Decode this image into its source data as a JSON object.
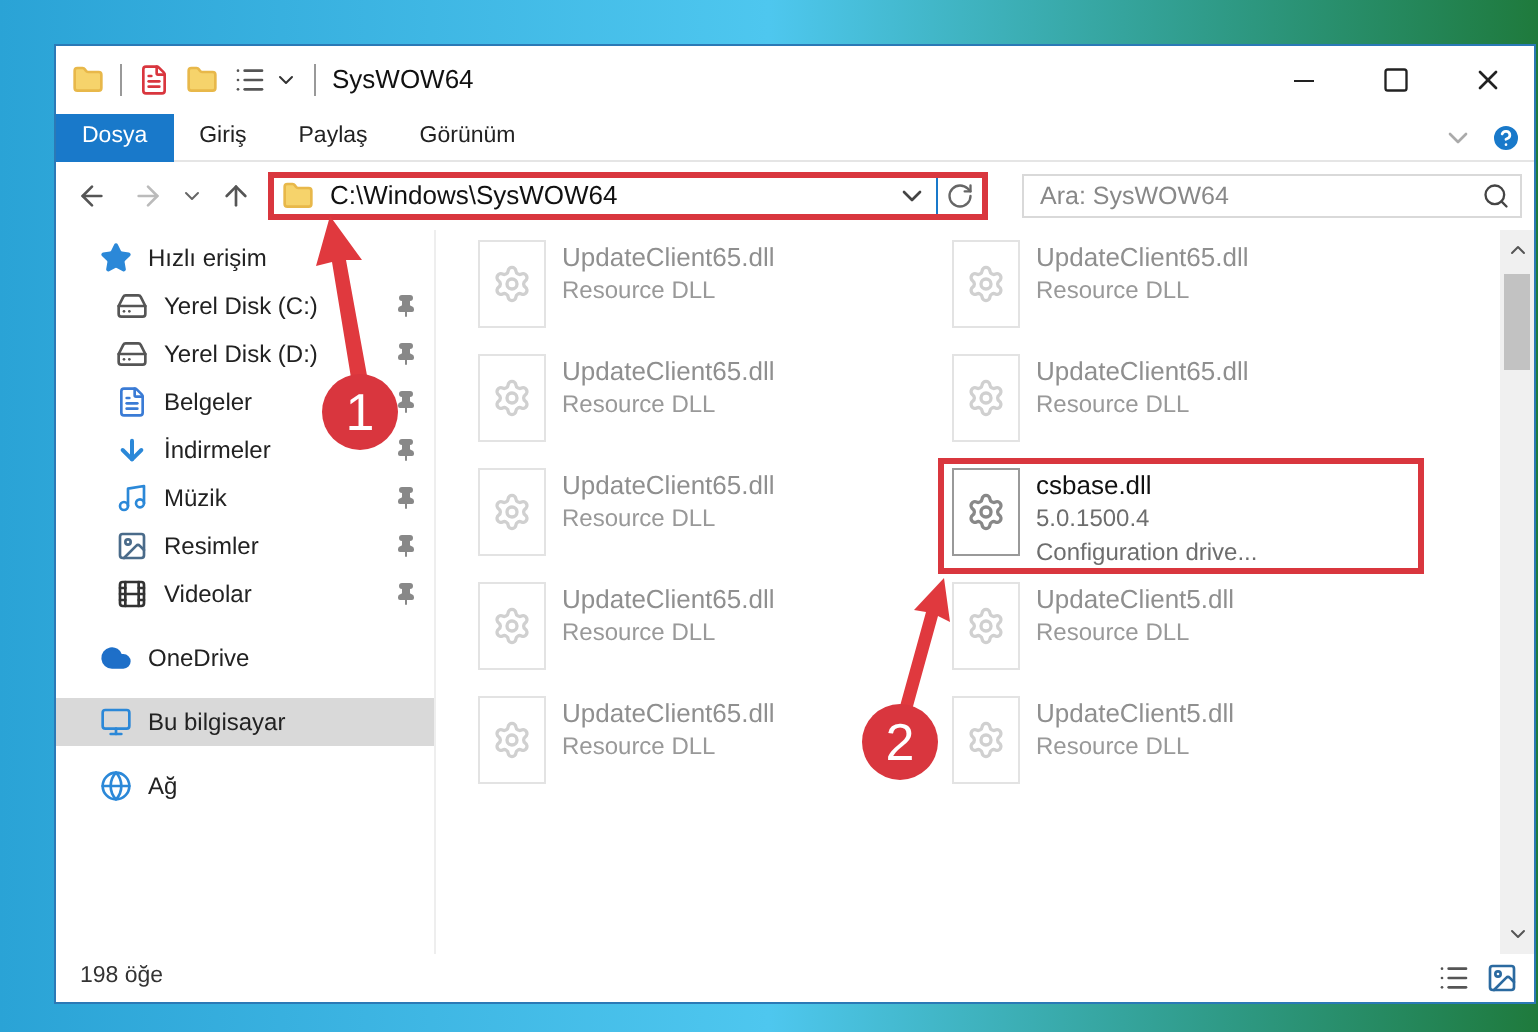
{
  "window": {
    "title": "SysWOW64"
  },
  "ribbon_tabs": [
    {
      "label": "Dosya",
      "selected": true
    },
    {
      "label": "Giriş",
      "selected": false
    },
    {
      "label": "Paylaş",
      "selected": false
    },
    {
      "label": "Görünüm",
      "selected": false
    }
  ],
  "address_bar": {
    "path": "C:\\Windows\\SysWOW64",
    "highlighted": true
  },
  "search": {
    "placeholder": "Ara: SysWOW64"
  },
  "sidebar": {
    "items": [
      {
        "label": "Hızlı erişim",
        "kind": "star",
        "selected": false,
        "children": [
          {
            "label": "Yerel Disk (C:)",
            "kind": "drive-c",
            "pinned": true
          },
          {
            "label": "Yerel Disk (D:)",
            "kind": "drive",
            "pinned": true
          },
          {
            "label": "Belgeler",
            "kind": "doc",
            "pinned": true
          },
          {
            "label": "İndirmeler",
            "kind": "download",
            "pinned": true
          },
          {
            "label": "Müzik",
            "kind": "music",
            "pinned": true
          },
          {
            "label": "Resimler",
            "kind": "picture",
            "pinned": true
          },
          {
            "label": "Videolar",
            "kind": "video",
            "pinned": true
          }
        ]
      },
      {
        "label": "OneDrive",
        "kind": "cloud",
        "selected": false
      },
      {
        "label": "Bu bilgisayar",
        "kind": "pc",
        "selected": true
      },
      {
        "label": "Ağ",
        "kind": "network",
        "selected": false
      }
    ]
  },
  "files": [
    {
      "name": "UpdateClient65.dll",
      "lines": [
        "Resource DLL"
      ],
      "kind": "blurred",
      "highlighted": false
    },
    {
      "name": "UpdateClient65.dll",
      "lines": [
        "Resource DLL"
      ],
      "kind": "blurred",
      "highlighted": false
    },
    {
      "name": "UpdateClient65.dll",
      "lines": [
        "Resource DLL"
      ],
      "kind": "blurred",
      "highlighted": false
    },
    {
      "name": "UpdateClient65.dll",
      "lines": [
        "Resource DLL"
      ],
      "kind": "blurred",
      "highlighted": false
    },
    {
      "name": "UpdateClient65.dll",
      "lines": [
        "Resource DLL"
      ],
      "kind": "blurred",
      "highlighted": false
    },
    {
      "name": "csbase.dll",
      "lines": [
        "5.0.1500.4",
        "Configuration drive..."
      ],
      "kind": "clear",
      "highlighted": true
    },
    {
      "name": "UpdateClient65.dll",
      "lines": [
        "Resource DLL"
      ],
      "kind": "blurred",
      "highlighted": false
    },
    {
      "name": "UpdateClient5.dll",
      "lines": [
        "Resource DLL"
      ],
      "kind": "blurred",
      "highlighted": false
    },
    {
      "name": "UpdateClient65.dll",
      "lines": [
        "Resource DLL"
      ],
      "kind": "blurred",
      "highlighted": false
    },
    {
      "name": "UpdateClient5.dll",
      "lines": [
        "Resource DLL"
      ],
      "kind": "blurred",
      "highlighted": false
    }
  ],
  "status_bar": {
    "count": "198 öğe"
  },
  "annotations": [
    {
      "number": "1"
    },
    {
      "number": "2"
    }
  ]
}
